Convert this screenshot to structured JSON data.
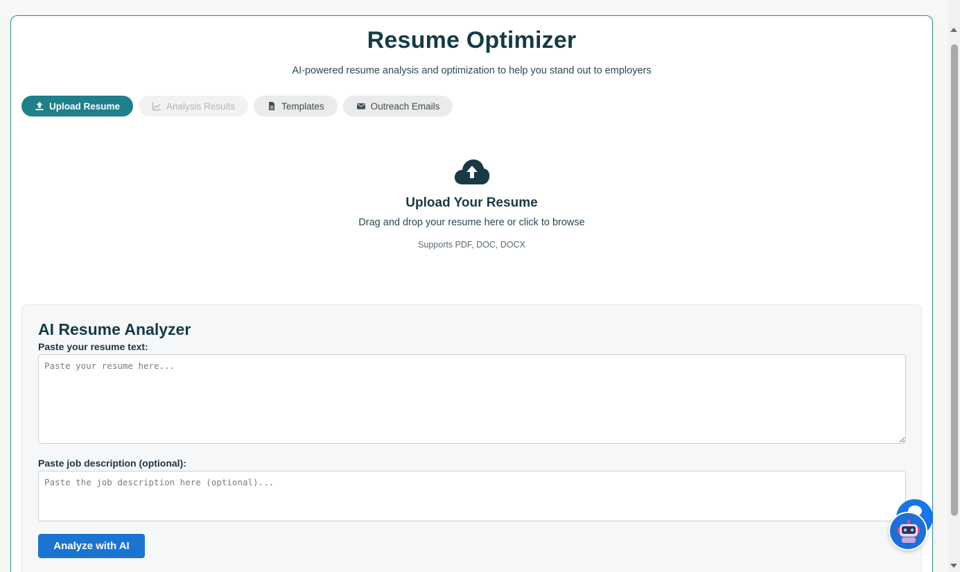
{
  "header": {
    "title": "Resume Optimizer",
    "subtitle": "AI-powered resume analysis and optimization to help you stand out to employers"
  },
  "tabs": [
    {
      "label": "Upload Resume",
      "icon": "upload-icon",
      "state": "active"
    },
    {
      "label": "Analysis Results",
      "icon": "chart-line-icon",
      "state": "disabled"
    },
    {
      "label": "Templates",
      "icon": "file-icon",
      "state": "normal"
    },
    {
      "label": "Outreach Emails",
      "icon": "envelope-icon",
      "state": "normal"
    }
  ],
  "upload": {
    "icon": "cloud-upload-icon",
    "title": "Upload Your Resume",
    "description": "Drag and drop your resume here or click to browse",
    "supports": "Supports PDF, DOC, DOCX"
  },
  "analyzer": {
    "title": "AI Resume Analyzer",
    "resume_label": "Paste your resume text:",
    "resume_placeholder": "Paste your resume here...",
    "resume_value": "",
    "job_label": "Paste job description (optional):",
    "job_placeholder": "Paste the job description here (optional)...",
    "job_value": "",
    "button_label": "Analyze with AI"
  },
  "colors": {
    "accent": "#1f7f8a",
    "primary_button": "#1b75d0",
    "title": "#173a45"
  },
  "widgets": {
    "chat_bubble_icon": "chat-bubble-icon",
    "assistant_icon": "robot-icon"
  }
}
